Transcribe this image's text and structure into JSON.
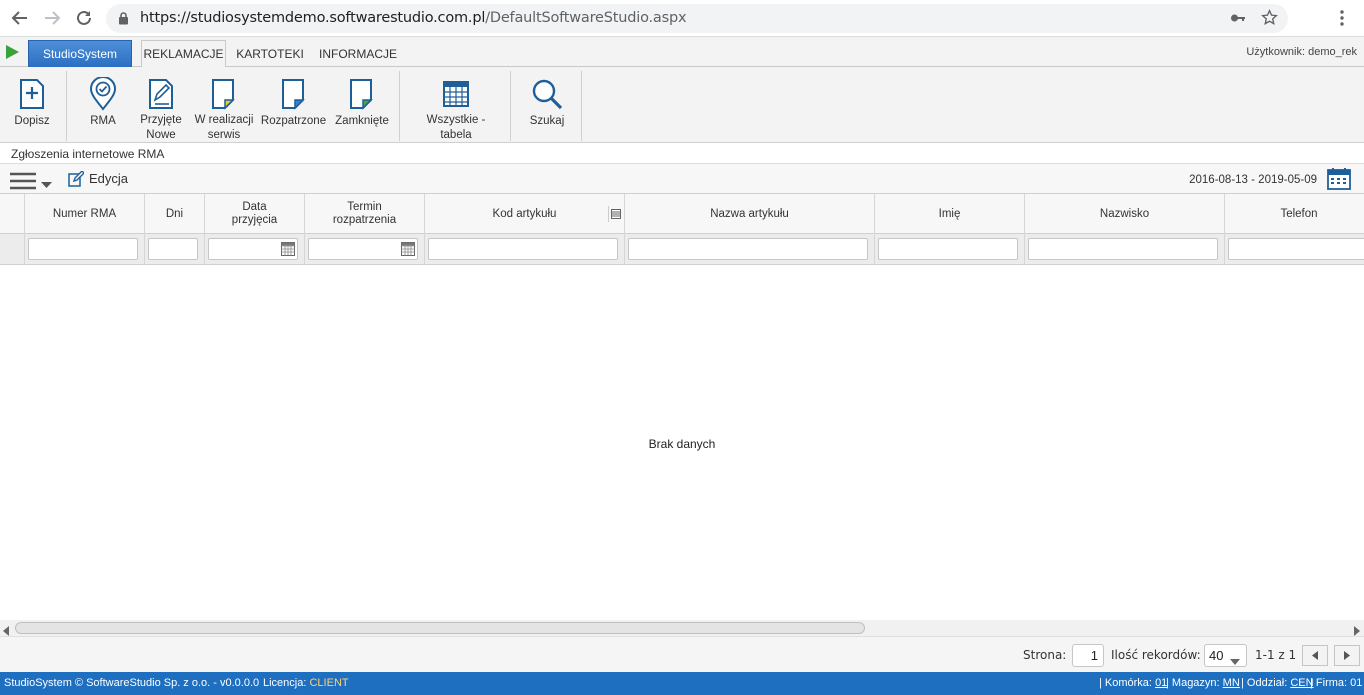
{
  "browser": {
    "url_host": "https://studiosystemdemo.softwarestudio.com.pl",
    "url_path": "/DefaultSoftwareStudio.aspx"
  },
  "appbar": {
    "brand_tab": "StudioSystem",
    "tabs": [
      {
        "label": "REKLAMACJE",
        "active": true
      },
      {
        "label": "KARTOTEKI",
        "active": false
      },
      {
        "label": "INFORMACJE",
        "active": false
      }
    ],
    "user_label": "Użytkownik: demo_rek"
  },
  "ribbon": {
    "buttons": [
      {
        "label": "Dopisz",
        "icon": "add-document-icon"
      },
      {
        "label": "RMA",
        "icon": "location-check-icon"
      },
      {
        "label": "Przyjęte\nNowe",
        "icon": "edit-document-icon"
      },
      {
        "label": "W realizacji\nserwis",
        "icon": "document-yellow-icon"
      },
      {
        "label": "Rozpatrzone",
        "icon": "document-blue-icon"
      },
      {
        "label": "Zamknięte",
        "icon": "document-green-icon"
      },
      {
        "label": "Wszystkie - tabela",
        "icon": "table-icon"
      },
      {
        "label": "Szukaj",
        "icon": "search-icon"
      }
    ]
  },
  "section": {
    "title": "Zgłoszenia internetowe RMA"
  },
  "toolbar": {
    "edit_label": "Edycja",
    "date_range": "2016-08-13 - 2019-05-09"
  },
  "grid": {
    "columns": [
      {
        "label": "Numer RMA"
      },
      {
        "label": "Dni"
      },
      {
        "label": "Data\nprzyjęcia"
      },
      {
        "label": "Termin\nrozpatrzenia"
      },
      {
        "label": "Kod artykułu"
      },
      {
        "label": "Nazwa artykułu"
      },
      {
        "label": "Imię"
      },
      {
        "label": "Nazwisko"
      },
      {
        "label": "Telefon"
      }
    ],
    "empty_text": "Brak danych"
  },
  "pager": {
    "page_label": "Strona:",
    "page_value": "1",
    "records_label": "Ilość rekordów:",
    "records_value": "40",
    "range_text": "1-1 z 1"
  },
  "status": {
    "copyright": "StudioSystem © SoftwareStudio Sp. z o.o. - v0.0.0.0",
    "license_label": "Licencja:",
    "license_value": "CLIENT",
    "cell_label": "| Komórka:",
    "cell_value": "01",
    "warehouse_label": "| Magazyn:",
    "warehouse_value": "MN",
    "branch_label": "| Oddział:",
    "branch_value": "CEN",
    "company_label": "| Firma:",
    "company_value": "01"
  }
}
